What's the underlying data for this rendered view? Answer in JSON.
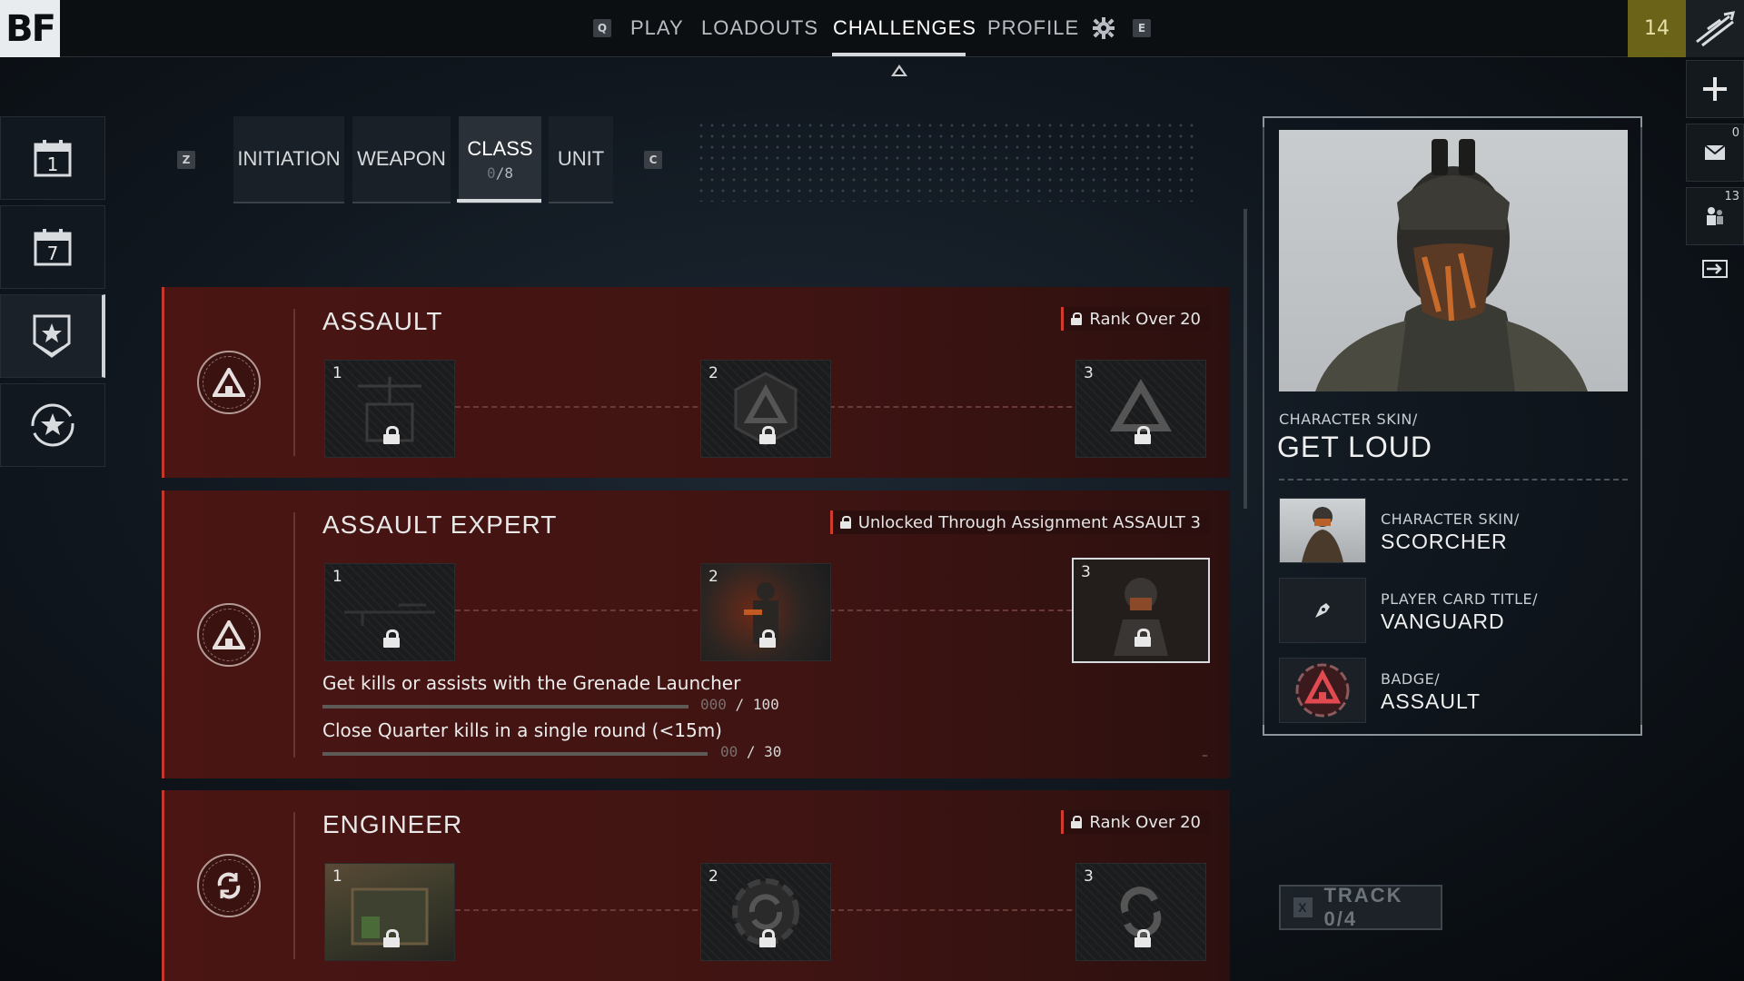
{
  "header": {
    "logo": "BF",
    "key_left": "Q",
    "key_right": "E",
    "nav": [
      {
        "label": "PLAY"
      },
      {
        "label": "LOADOUTS"
      },
      {
        "label": "CHALLENGES"
      },
      {
        "label": "PROFILE"
      }
    ],
    "active_nav": "CHALLENGES",
    "player_level": "14"
  },
  "right_bar": {
    "mail_count": "0",
    "squad_count": "13"
  },
  "left_rail": {
    "daily_label": "1",
    "weekly_label": "7"
  },
  "tabs": {
    "key_left": "Z",
    "key_right": "C",
    "items": [
      {
        "label": "INITIATION"
      },
      {
        "label": "WEAPON"
      },
      {
        "label": "CLASS",
        "progress_current": "0",
        "progress_total": "/8"
      },
      {
        "label": "UNIT"
      }
    ],
    "active": "CLASS"
  },
  "cards": [
    {
      "title": "ASSAULT",
      "requirement": "Rank Over 20",
      "slots": [
        "1",
        "2",
        "3"
      ]
    },
    {
      "title": "ASSAULT EXPERT",
      "requirement": "Unlocked Through Assignment ASSAULT 3",
      "slots": [
        "1",
        "2",
        "3"
      ],
      "tasks": [
        {
          "text": "Get kills or assists with the Grenade Launcher",
          "current": "000",
          "total": "/ 100",
          "progress": 0
        },
        {
          "text": "Close Quarter kills in a single round (<15m)",
          "current": "00",
          "total": "/ 30",
          "progress": 0
        }
      ],
      "footer_mark": "–"
    },
    {
      "title": "ENGINEER",
      "requirement": "Rank Over 20",
      "slots": [
        "1",
        "2",
        "3"
      ]
    }
  ],
  "rewards": {
    "main": {
      "type": "CHARACTER SKIN/",
      "name": "GET LOUD"
    },
    "list": [
      {
        "type": "CHARACTER SKIN/",
        "name": "SCORCHER"
      },
      {
        "type": "PLAYER CARD TITLE/",
        "name": "VANGUARD"
      },
      {
        "type": "BADGE/",
        "name": "ASSAULT"
      }
    ]
  },
  "track": {
    "key": "X",
    "label": "TRACK 0/4"
  },
  "colors": {
    "card_bg": "#4a1513",
    "accent_red": "#c2392c",
    "level_badge": "#6b6418"
  }
}
